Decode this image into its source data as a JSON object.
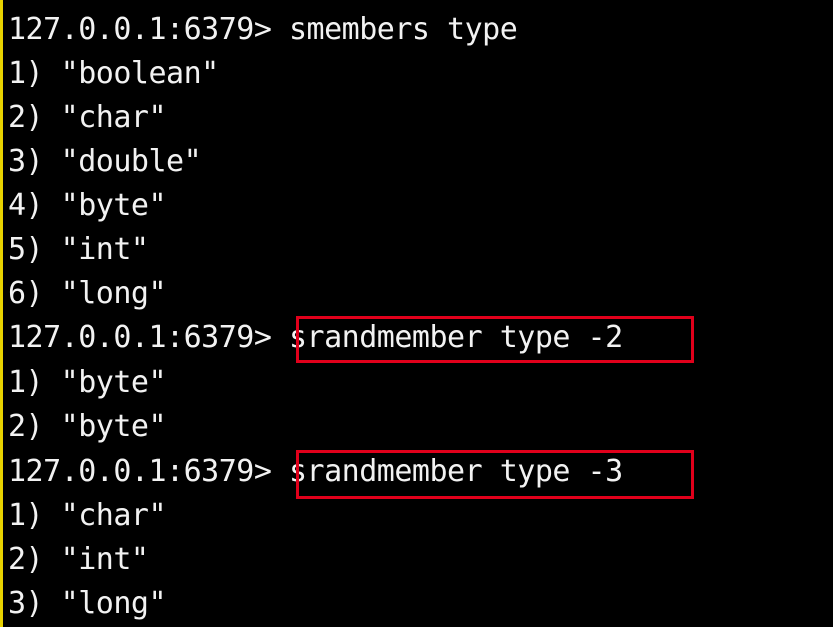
{
  "terminal": {
    "lines": [
      {
        "kind": "prompt",
        "prompt": "127.0.0.1:6379>",
        "command": "smembers type"
      },
      {
        "kind": "output",
        "text": "1) \"boolean\""
      },
      {
        "kind": "output",
        "text": "2) \"char\""
      },
      {
        "kind": "output",
        "text": "3) \"double\""
      },
      {
        "kind": "output",
        "text": "4) \"byte\""
      },
      {
        "kind": "output",
        "text": "5) \"int\""
      },
      {
        "kind": "output",
        "text": "6) \"long\""
      },
      {
        "kind": "prompt",
        "prompt": "127.0.0.1:6379>",
        "command": "srandmember type -2",
        "highlighted": true
      },
      {
        "kind": "output",
        "text": "1) \"byte\""
      },
      {
        "kind": "output",
        "text": "2) \"byte\""
      },
      {
        "kind": "prompt",
        "prompt": "127.0.0.1:6379>",
        "command": "srandmember type -3",
        "highlighted": true
      },
      {
        "kind": "output",
        "text": "1) \"char\""
      },
      {
        "kind": "output",
        "text": "2) \"int\""
      },
      {
        "kind": "output",
        "text": "3) \"long\""
      }
    ]
  },
  "colors": {
    "background": "#000000",
    "text": "#f2f2f2",
    "highlight_border": "#e0001b",
    "cursor_bar": "#e8d200"
  }
}
